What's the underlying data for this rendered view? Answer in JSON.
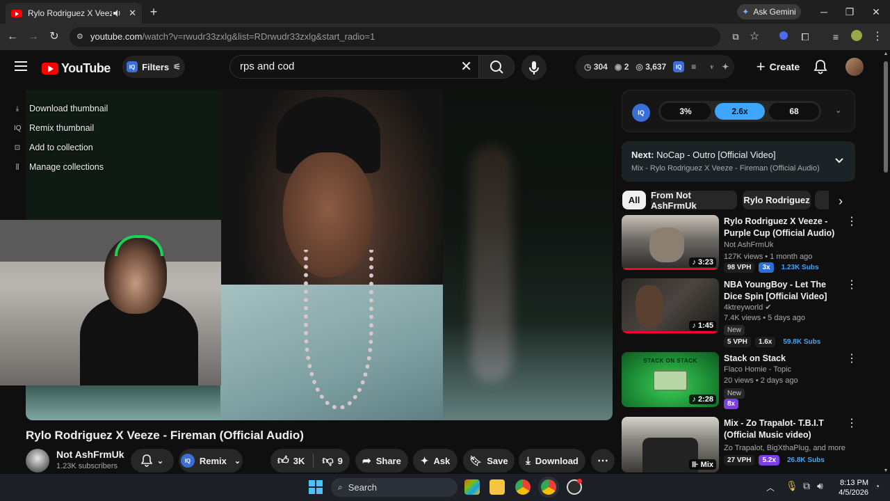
{
  "browser": {
    "tab_title": "Rylo Rodriguez X Veeze - Fi",
    "url_host": "youtube.com",
    "url_rest": "/watch?v=rwudr33zxlg&list=RDrwudr33zxlg&start_radio=1",
    "gemini_label": "Ask Gemini"
  },
  "header": {
    "logo_text": "YouTube",
    "filters_label": "Filters",
    "search_value": "rps and cod",
    "stats": {
      "time": "304",
      "watching": "2",
      "views": "3,637"
    },
    "create_label": "Create"
  },
  "thumb_menu": {
    "items": [
      {
        "label": "Download thumbnail"
      },
      {
        "label": "Remix thumbnail"
      },
      {
        "label": "Add to collection"
      },
      {
        "label": "Manage collections"
      }
    ]
  },
  "video": {
    "title": "Rylo Rodriguez X Veeze - Fireman (Official Audio)",
    "channel": "Not AshFrmUk",
    "subscribers": "1.23K subscribers",
    "remix_label": "Remix",
    "likes": "3K",
    "dislikes": "9",
    "share_label": "Share",
    "ask_label": "Ask",
    "save_label": "Save",
    "download_label": "Download"
  },
  "iq_panel": {
    "logo": "IQ",
    "chips": [
      "3%",
      "2.6x",
      "68"
    ]
  },
  "next_up": {
    "prefix": "Next:",
    "title": "NoCap - Outro [Official Video]",
    "mix": "Mix - Rylo Rodriguez X Veeze - Fireman (Official Audio)"
  },
  "filter_chips": [
    "All",
    "From Not AshFrmUk",
    "Rylo Rodriguez"
  ],
  "related": [
    {
      "title": "Rylo Rodriguez X Veeze - Purple Cup (Official Audio)",
      "channel": "Not AshFrmUk",
      "meta": "127K views • 1 month ago",
      "duration": "3:23",
      "progress": 1.0,
      "badges": [
        "98 VPH",
        "3x",
        "1.23K Subs"
      ]
    },
    {
      "title": "NBA YoungBoy - Let The Dice Spin [Official Video]",
      "channel": "4ktreyworld",
      "meta": "7.4K views • 5 days ago",
      "duration": "1:45",
      "progress": 1.0,
      "new": "New",
      "badges": [
        "5 VPH",
        "1.6x",
        "59.8K Subs"
      ]
    },
    {
      "title": "Stack on Stack",
      "channel": "Flaco Homie - Topic",
      "meta": "20 views • 2 days ago",
      "duration": "2:28",
      "new": "New",
      "badges": [
        "8x"
      ],
      "thumb_text": "STACK ON STACK"
    },
    {
      "title": "Mix - Zo Trapalot- T.B.I.T (Official Music video)",
      "channel": "Zo Trapalot, BigXthaPlug, and more",
      "duration": "Mix",
      "badges": [
        "27 VPH",
        "5.2x",
        "26.8K Subs"
      ]
    }
  ],
  "taskbar": {
    "search_label": "Search",
    "time": "8:13 PM",
    "date": "4/5/2026"
  },
  "colors": {
    "youtube_red": "#ff0000",
    "accent_blue": "#3ea6ff",
    "iq_blue": "#3a6fd8",
    "purple_badge": "#7b3fe4"
  }
}
